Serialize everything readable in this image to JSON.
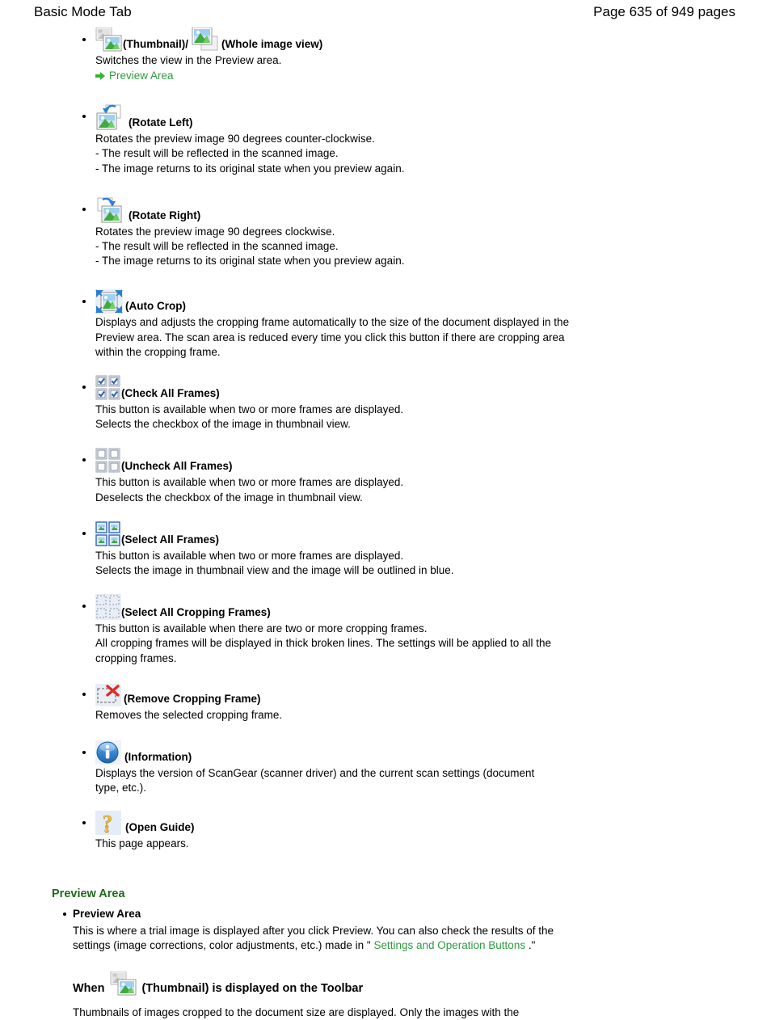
{
  "header": {
    "title": "Basic Mode Tab",
    "page_label": "Page 635 of 949 pages"
  },
  "toolbar_items": [
    {
      "icons": [
        "thumbnail-icon",
        "whole-image-view-icon"
      ],
      "label1": "(Thumbnail)/",
      "label2": "(Whole image view)",
      "desc": [
        "Switches the view in the Preview area."
      ],
      "link": "Preview Area"
    },
    {
      "icons": [
        "rotate-left-icon"
      ],
      "label1": "(Rotate Left)",
      "desc": [
        "Rotates the preview image 90 degrees counter-clockwise.",
        "- The result will be reflected in the scanned image.",
        "- The image returns to its original state when you preview again."
      ]
    },
    {
      "icons": [
        "rotate-right-icon"
      ],
      "label1": "(Rotate Right)",
      "desc": [
        "Rotates the preview image 90 degrees clockwise.",
        "- The result will be reflected in the scanned image.",
        "- The image returns to its original state when you preview again."
      ]
    },
    {
      "icons": [
        "auto-crop-icon"
      ],
      "label1": "(Auto Crop)",
      "desc": [
        "Displays and adjusts the cropping frame automatically to the size of the document displayed in the Preview area. The scan area is reduced every time you click this button if there are cropping area within the cropping frame."
      ]
    },
    {
      "icons": [
        "check-all-frames-icon"
      ],
      "label1": "(Check All Frames)",
      "desc": [
        "This button is available when two or more frames are displayed.",
        "Selects the checkbox of the image in thumbnail view."
      ]
    },
    {
      "icons": [
        "uncheck-all-frames-icon"
      ],
      "label1": "(Uncheck All Frames)",
      "desc": [
        "This button is available when two or more frames are displayed.",
        "Deselects the checkbox of the image in thumbnail view."
      ]
    },
    {
      "icons": [
        "select-all-frames-icon"
      ],
      "label1": "(Select All Frames)",
      "desc": [
        "This button is available when two or more frames are displayed.",
        "Selects the image in thumbnail view and the image will be outlined in blue."
      ]
    },
    {
      "icons": [
        "select-all-cropping-frames-icon"
      ],
      "label1": "(Select All Cropping Frames)",
      "desc": [
        "This button is available when there are two or more cropping frames.",
        "All cropping frames will be displayed in thick broken lines. The settings will be applied to all the cropping frames."
      ]
    },
    {
      "icons": [
        "remove-cropping-frame-icon"
      ],
      "label1": "(Remove Cropping Frame)",
      "desc": [
        "Removes the selected cropping frame."
      ]
    },
    {
      "icons": [
        "information-icon"
      ],
      "label1": "(Information)",
      "desc": [
        "Displays the version of ScanGear (scanner driver) and the current scan settings (document type, etc.)."
      ]
    },
    {
      "icons": [
        "open-guide-icon"
      ],
      "label1": "(Open Guide)",
      "desc": [
        "This page appears."
      ]
    }
  ],
  "preview_section": {
    "heading": "Preview Area",
    "sub_title": "Preview Area",
    "desc_part1": "This is where a trial image is displayed after you click Preview. You can also check the results of the settings (image corrections, color adjustments, etc.) made in \" ",
    "desc_link": "Settings and Operation Buttons",
    "desc_part2": " .\"",
    "when_prefix": "When",
    "when_suffix": "(Thumbnail) is displayed on the Toolbar",
    "trailing": "Thumbnails of images cropped to the document size are displayed. Only the images with the"
  },
  "colors": {
    "link_green": "#2f9c3f",
    "heading_green": "#1d6a1d",
    "text_black": "#000000"
  }
}
